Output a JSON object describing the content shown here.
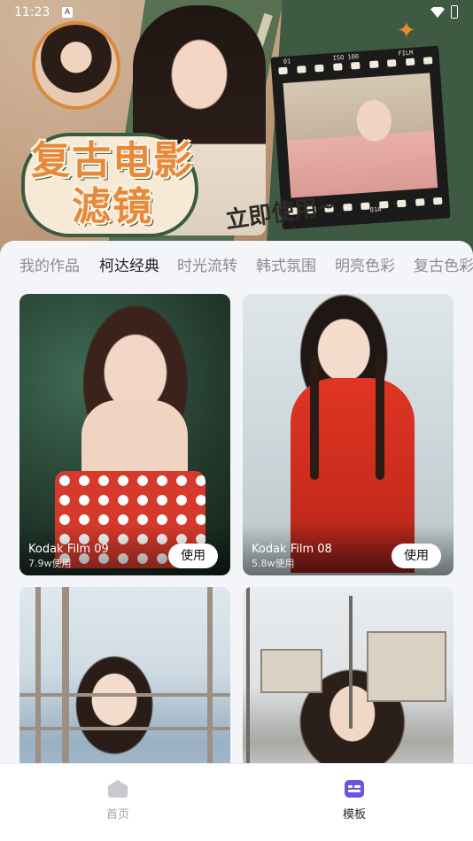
{
  "status_bar": {
    "time": "11:23",
    "a_icon_text": "A"
  },
  "banner": {
    "title_line1": "复古电影",
    "title_line2": "滤镜",
    "cta_handwritten": "立即使用~",
    "film_labels": [
      "01",
      "ISO 100",
      "FILM",
      "01A"
    ]
  },
  "tabs": {
    "items": [
      "我的作品",
      "柯达经典",
      "时光流转",
      "韩式氛围",
      "明亮色彩",
      "复古色彩"
    ],
    "active_index": 1
  },
  "cards": [
    {
      "title": "Kodak Film 09",
      "uses": "7.9w使用",
      "button": "使用"
    },
    {
      "title": "Kodak Film 08",
      "uses": "5.8w使用",
      "button": "使用"
    },
    {
      "title": "",
      "uses": "",
      "button": ""
    },
    {
      "title": "",
      "uses": "",
      "button": ""
    }
  ],
  "bottom_nav": {
    "home_label": "首页",
    "template_label": "模板",
    "active": "template"
  },
  "colors": {
    "accent": "#6a55e0",
    "banner_green": "#3f5a43",
    "banner_orange": "#e6893a"
  }
}
